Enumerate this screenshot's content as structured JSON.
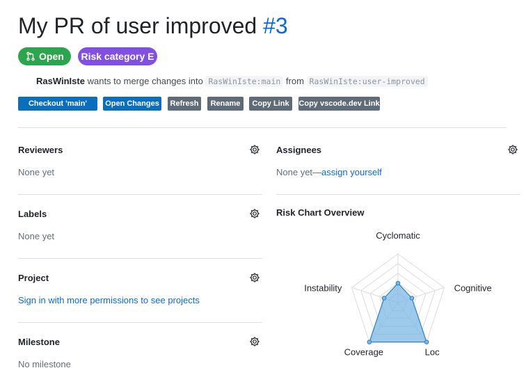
{
  "header": {
    "title": "My PR of user improved",
    "number": "#3",
    "status": "Open",
    "risk_badge": "Risk category E",
    "author": "RasWinIste",
    "merge_text": "wants to merge changes into",
    "base_branch": "RasWinIste:main",
    "from_text": "from",
    "head_branch": "RasWinIste:user-improved"
  },
  "actions": {
    "checkout": "Checkout 'main'",
    "open_changes": "Open Changes",
    "refresh": "Refresh",
    "rename": "Rename",
    "copy_link": "Copy Link",
    "copy_vscode": "Copy vscode.dev Link"
  },
  "sidebar": {
    "reviewers": {
      "title": "Reviewers",
      "value": "None yet"
    },
    "assignees": {
      "title": "Assignees",
      "value": "None yet—",
      "link": "assign yourself"
    },
    "labels": {
      "title": "Labels",
      "value": "None yet"
    },
    "project": {
      "title": "Project",
      "link": "Sign in with more permissions to see projects"
    },
    "milestone": {
      "title": "Milestone",
      "value": "No milestone"
    }
  },
  "risk_chart": {
    "title": "Risk Chart Overview"
  },
  "chart_data": {
    "type": "radar",
    "categories": [
      "Cyclomatic",
      "Cognitive",
      "Loc",
      "Coverage",
      "Instability"
    ],
    "values": [
      0.4,
      0.3,
      1.0,
      1.0,
      0.3
    ],
    "rlim": [
      0,
      1
    ],
    "rings": 5,
    "fill_color": "#7cb7e3",
    "stroke_color": "#2f7fc1"
  },
  "colors": {
    "open": "#2da44e",
    "risk": "#8250df",
    "link": "#0969da",
    "btn_primary": "#0a6ebd",
    "btn_secondary": "#5f6b77"
  }
}
